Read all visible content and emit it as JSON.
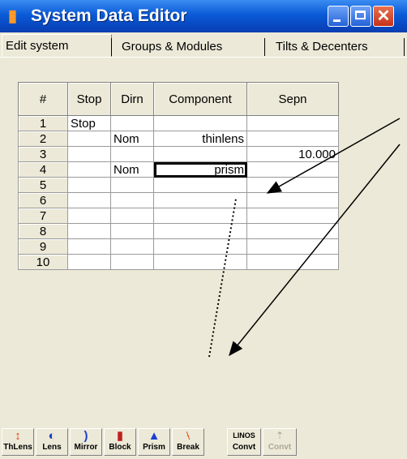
{
  "window": {
    "title": "System Data Editor",
    "app_icon": "orange-app-icon"
  },
  "tabs": [
    "Edit system",
    "Groups & Modules",
    "Tilts & Decenters"
  ],
  "grid": {
    "headers": [
      "#",
      "Stop",
      "Dirn",
      "Component",
      "Sepn"
    ],
    "rows": [
      [
        "1",
        "Stop",
        "",
        "",
        ""
      ],
      [
        "2",
        "",
        "Nom",
        "thinlens",
        ""
      ],
      [
        "3",
        "",
        "",
        "",
        "10.000"
      ],
      [
        "4",
        "",
        "Nom",
        "prism",
        ""
      ],
      [
        "5",
        "",
        "",
        "",
        ""
      ],
      [
        "6",
        "",
        "",
        "",
        ""
      ],
      [
        "7",
        "",
        "",
        "",
        ""
      ],
      [
        "8",
        "",
        "",
        "",
        ""
      ],
      [
        "9",
        "",
        "",
        "",
        ""
      ],
      [
        "10",
        "",
        "",
        "",
        ""
      ]
    ]
  },
  "toolbar": {
    "buttons": [
      "ThLens",
      "Lens",
      "Mirror",
      "Block",
      "Prism",
      "Break"
    ],
    "linos_label": "LINOS",
    "convt": "Convt",
    "convt2": "Convt"
  },
  "colors": {
    "title_bar": "#0a5bd7",
    "close": "#c5321a",
    "window_bg": "#ece9d8"
  }
}
